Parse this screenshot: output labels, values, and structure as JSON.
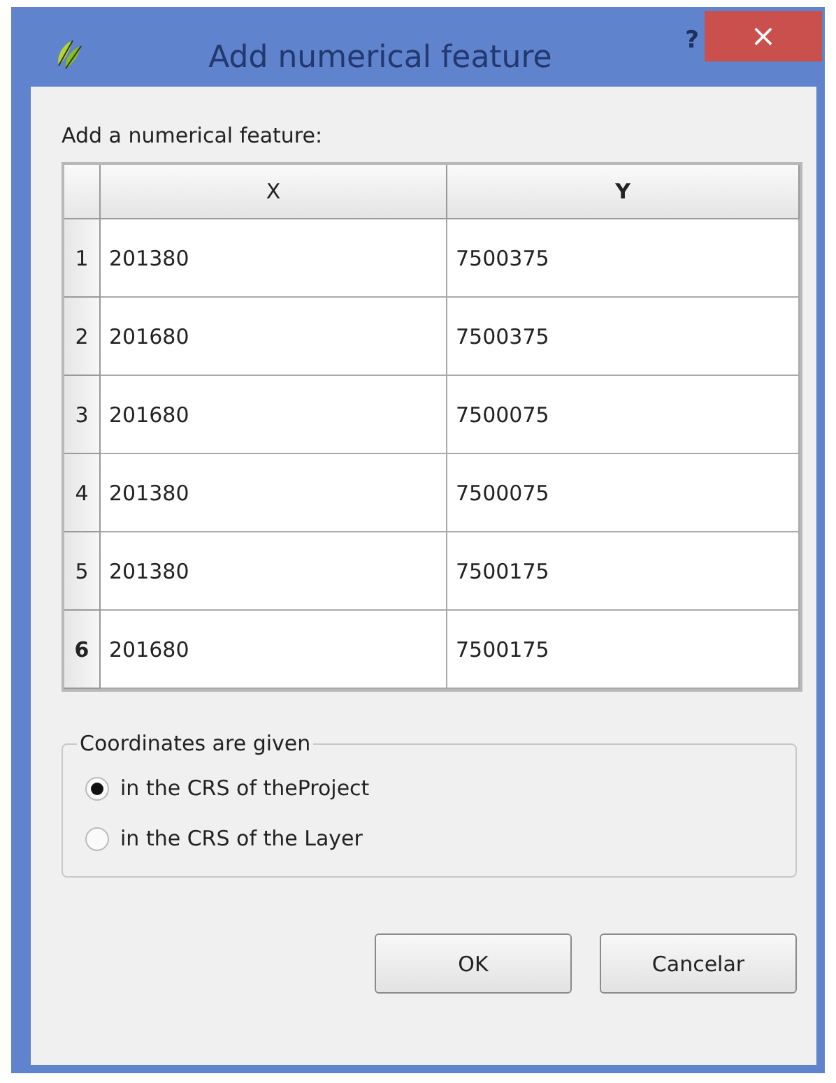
{
  "window": {
    "title": "Add numerical feature",
    "help": "?",
    "close": "×"
  },
  "prompt": "Add a numerical feature:",
  "table": {
    "columns": [
      {
        "label": "X",
        "selected": false
      },
      {
        "label": "Y",
        "selected": true
      }
    ],
    "rows": [
      {
        "header": "1",
        "selected": false,
        "cells": [
          "201380",
          "7500375"
        ]
      },
      {
        "header": "2",
        "selected": false,
        "cells": [
          "201680",
          "7500375"
        ]
      },
      {
        "header": "3",
        "selected": false,
        "cells": [
          "201680",
          "7500075"
        ]
      },
      {
        "header": "4",
        "selected": false,
        "cells": [
          "201380",
          "7500075"
        ]
      },
      {
        "header": "5",
        "selected": false,
        "cells": [
          "201380",
          "7500175"
        ]
      },
      {
        "header": "6",
        "selected": true,
        "cells": [
          "201680",
          "7500175"
        ]
      }
    ]
  },
  "group": {
    "title": "Coordinates are given",
    "options": [
      {
        "label": "in the CRS of theProject",
        "selected": true
      },
      {
        "label": "in the CRS of the Layer",
        "selected": false
      }
    ]
  },
  "buttons": [
    "OK",
    "Cancelar"
  ]
}
